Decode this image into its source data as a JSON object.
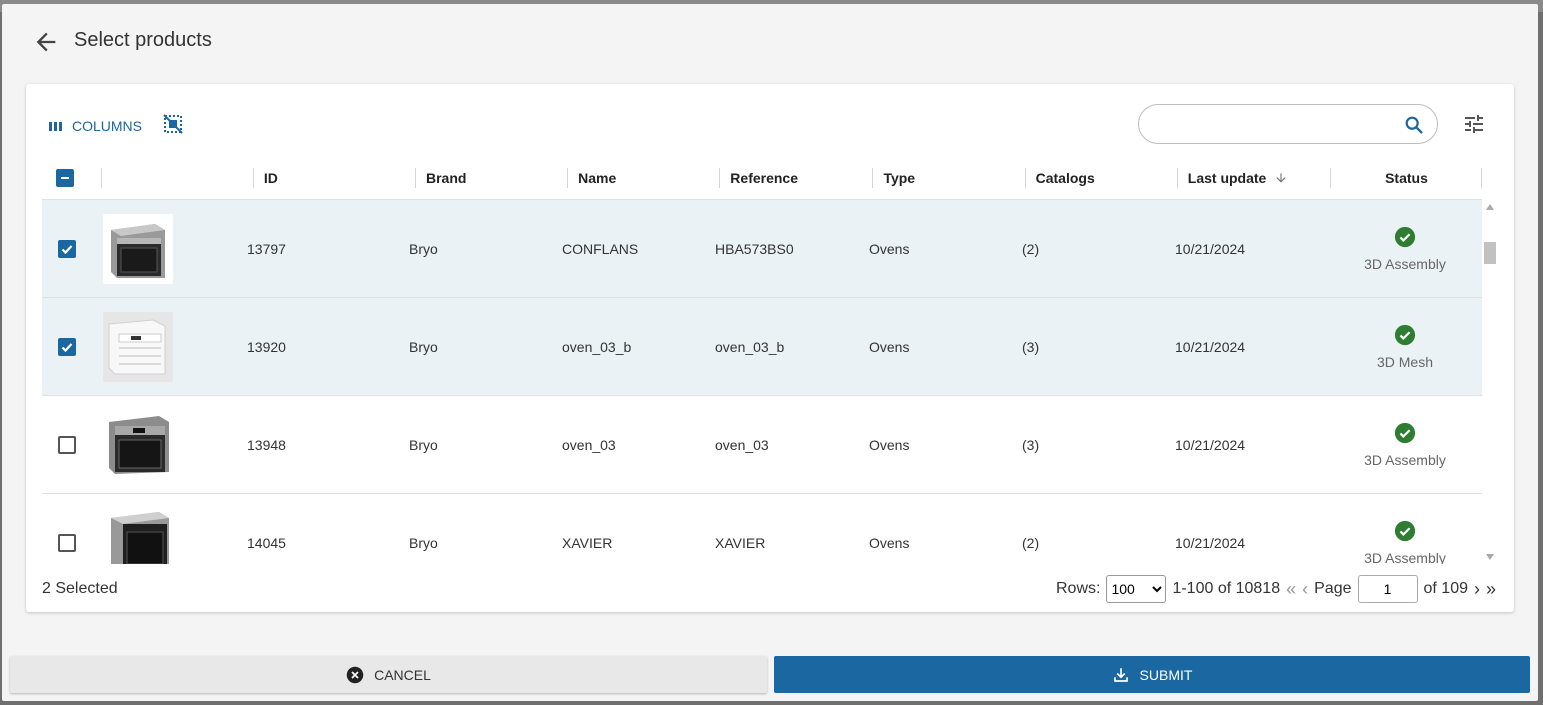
{
  "dialog": {
    "title": "Select products"
  },
  "toolbar": {
    "columns_label": "COLUMNS",
    "search_placeholder": ""
  },
  "table": {
    "headers": {
      "id": "ID",
      "brand": "Brand",
      "name": "Name",
      "reference": "Reference",
      "type": "Type",
      "catalogs": "Catalogs",
      "last_update": "Last update",
      "status": "Status"
    },
    "rows": [
      {
        "checked": true,
        "id": "13797",
        "brand": "Bryo",
        "name": "CONFLANS",
        "reference": "HBA573BS0",
        "type": "Ovens",
        "catalogs": "(2)",
        "last_update": "10/21/2024",
        "status": "3D Assembly"
      },
      {
        "checked": true,
        "id": "13920",
        "brand": "Bryo",
        "name": "oven_03_b",
        "reference": "oven_03_b",
        "type": "Ovens",
        "catalogs": "(3)",
        "last_update": "10/21/2024",
        "status": "3D Mesh"
      },
      {
        "checked": false,
        "id": "13948",
        "brand": "Bryo",
        "name": "oven_03",
        "reference": "oven_03",
        "type": "Ovens",
        "catalogs": "(3)",
        "last_update": "10/21/2024",
        "status": "3D Assembly"
      },
      {
        "checked": false,
        "id": "14045",
        "brand": "Bryo",
        "name": "XAVIER",
        "reference": "XAVIER",
        "type": "Ovens",
        "catalogs": "(2)",
        "last_update": "10/21/2024",
        "status": "3D Assembly"
      }
    ]
  },
  "footer": {
    "selected": "2 Selected",
    "rows_label": "Rows:",
    "rows_value": "100",
    "range": "1-100 of 10818",
    "page_label": "Page",
    "page_value": "1",
    "of_pages": "of 109"
  },
  "actions": {
    "cancel": "CANCEL",
    "submit": "SUBMIT"
  },
  "colors": {
    "accent": "#1b67a1",
    "status_ok": "#2e7d32",
    "selected_row": "#eaf2f6"
  }
}
